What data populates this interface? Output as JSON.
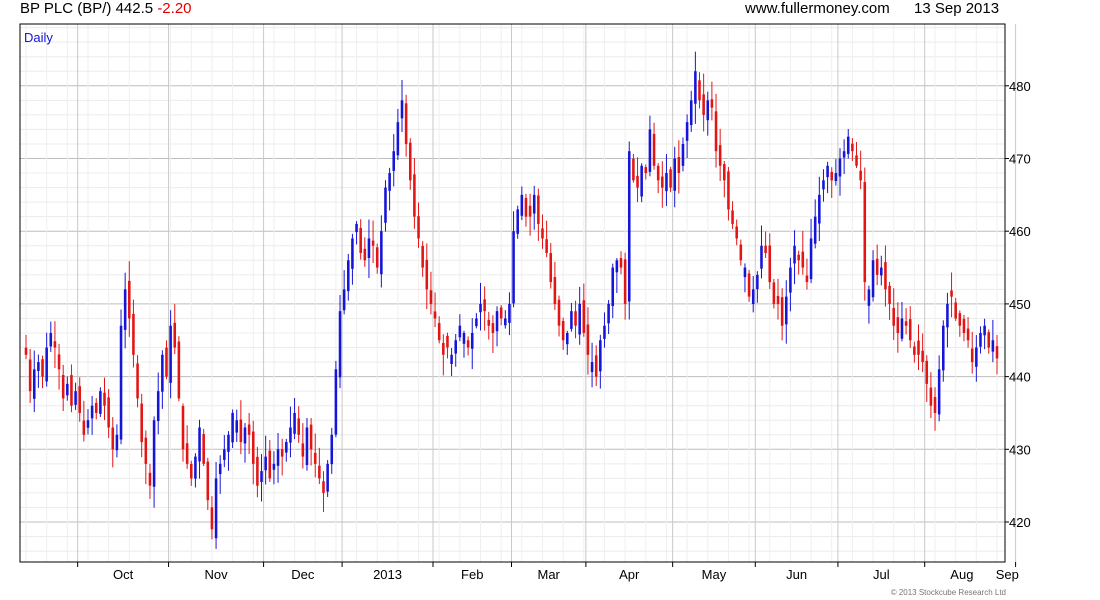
{
  "header": {
    "instrument": "BP PLC (BP/)",
    "last_price": "442.5",
    "change": "-2.20",
    "site": "www.fullermoney.com",
    "date": "13 Sep 2013"
  },
  "colors": {
    "up": "#1515d8",
    "down": "#e31414",
    "grid": "#d9d9d9",
    "frame": "#000000"
  },
  "chart_data": {
    "type": "candlestick",
    "period_label": "Daily",
    "y_ticks": [
      420,
      430,
      440,
      450,
      460,
      470,
      480
    ],
    "ylim": [
      414.5,
      488.5
    ],
    "x_tick_labels": [
      "Oct",
      "Nov",
      "Dec",
      "2013",
      "Feb",
      "Mar",
      "Apr",
      "May",
      "Jun",
      "Jul",
      "Aug",
      "Sep"
    ],
    "grid": true,
    "copyright": "© 2013 Stockcube Research Ltd",
    "series": [
      {
        "name": "BP PLC (BP/)",
        "close": [
          443,
          438,
          441,
          442,
          440,
          444,
          446,
          444,
          441,
          437,
          439,
          436,
          438,
          435,
          432,
          434,
          436,
          435,
          438,
          436,
          433,
          430,
          432,
          447,
          452,
          448,
          443,
          437,
          431,
          428,
          425,
          434,
          438,
          443,
          440,
          447,
          444,
          437,
          430,
          428,
          426,
          429,
          433,
          428,
          423,
          419,
          426,
          428,
          430,
          432,
          435,
          434,
          431,
          433,
          432,
          428,
          425,
          427,
          429,
          426,
          428,
          430,
          429,
          431,
          433,
          435,
          432,
          429,
          433,
          430,
          428,
          426,
          424,
          428,
          432,
          441,
          449,
          452,
          456,
          459,
          461,
          457,
          456,
          459,
          458,
          455,
          460,
          466,
          468,
          471,
          475,
          478,
          472,
          467,
          462,
          459,
          455,
          452,
          450,
          448,
          445,
          443,
          444,
          443,
          445,
          447,
          446,
          444,
          446,
          448,
          450,
          449,
          447,
          446,
          449,
          448,
          448,
          450,
          460,
          463,
          465,
          462,
          462,
          465,
          461,
          459,
          457,
          453,
          450,
          447,
          445,
          446,
          449,
          447,
          450,
          446,
          443,
          442,
          440,
          445,
          447,
          450,
          455,
          456,
          455,
          450,
          471,
          467,
          466,
          469,
          468,
          474,
          469,
          467,
          466,
          468,
          466,
          470,
          468,
          472,
          475,
          478,
          482,
          478,
          476,
          478,
          477,
          471,
          469,
          467,
          463,
          461,
          459,
          456,
          455,
          451,
          452,
          454,
          458,
          457,
          453,
          450,
          450,
          447,
          451,
          455,
          458,
          456,
          455,
          453,
          459,
          462,
          465,
          467,
          469,
          467,
          468,
          470,
          471,
          473,
          471,
          469,
          467,
          453,
          452,
          456,
          454,
          455,
          452,
          450,
          447,
          446,
          448,
          447,
          445,
          443,
          443,
          442,
          439,
          436,
          435,
          441,
          447,
          450,
          451,
          448,
          447,
          446,
          445,
          442,
          444,
          446,
          447,
          444,
          445,
          442.5
        ]
      }
    ]
  }
}
